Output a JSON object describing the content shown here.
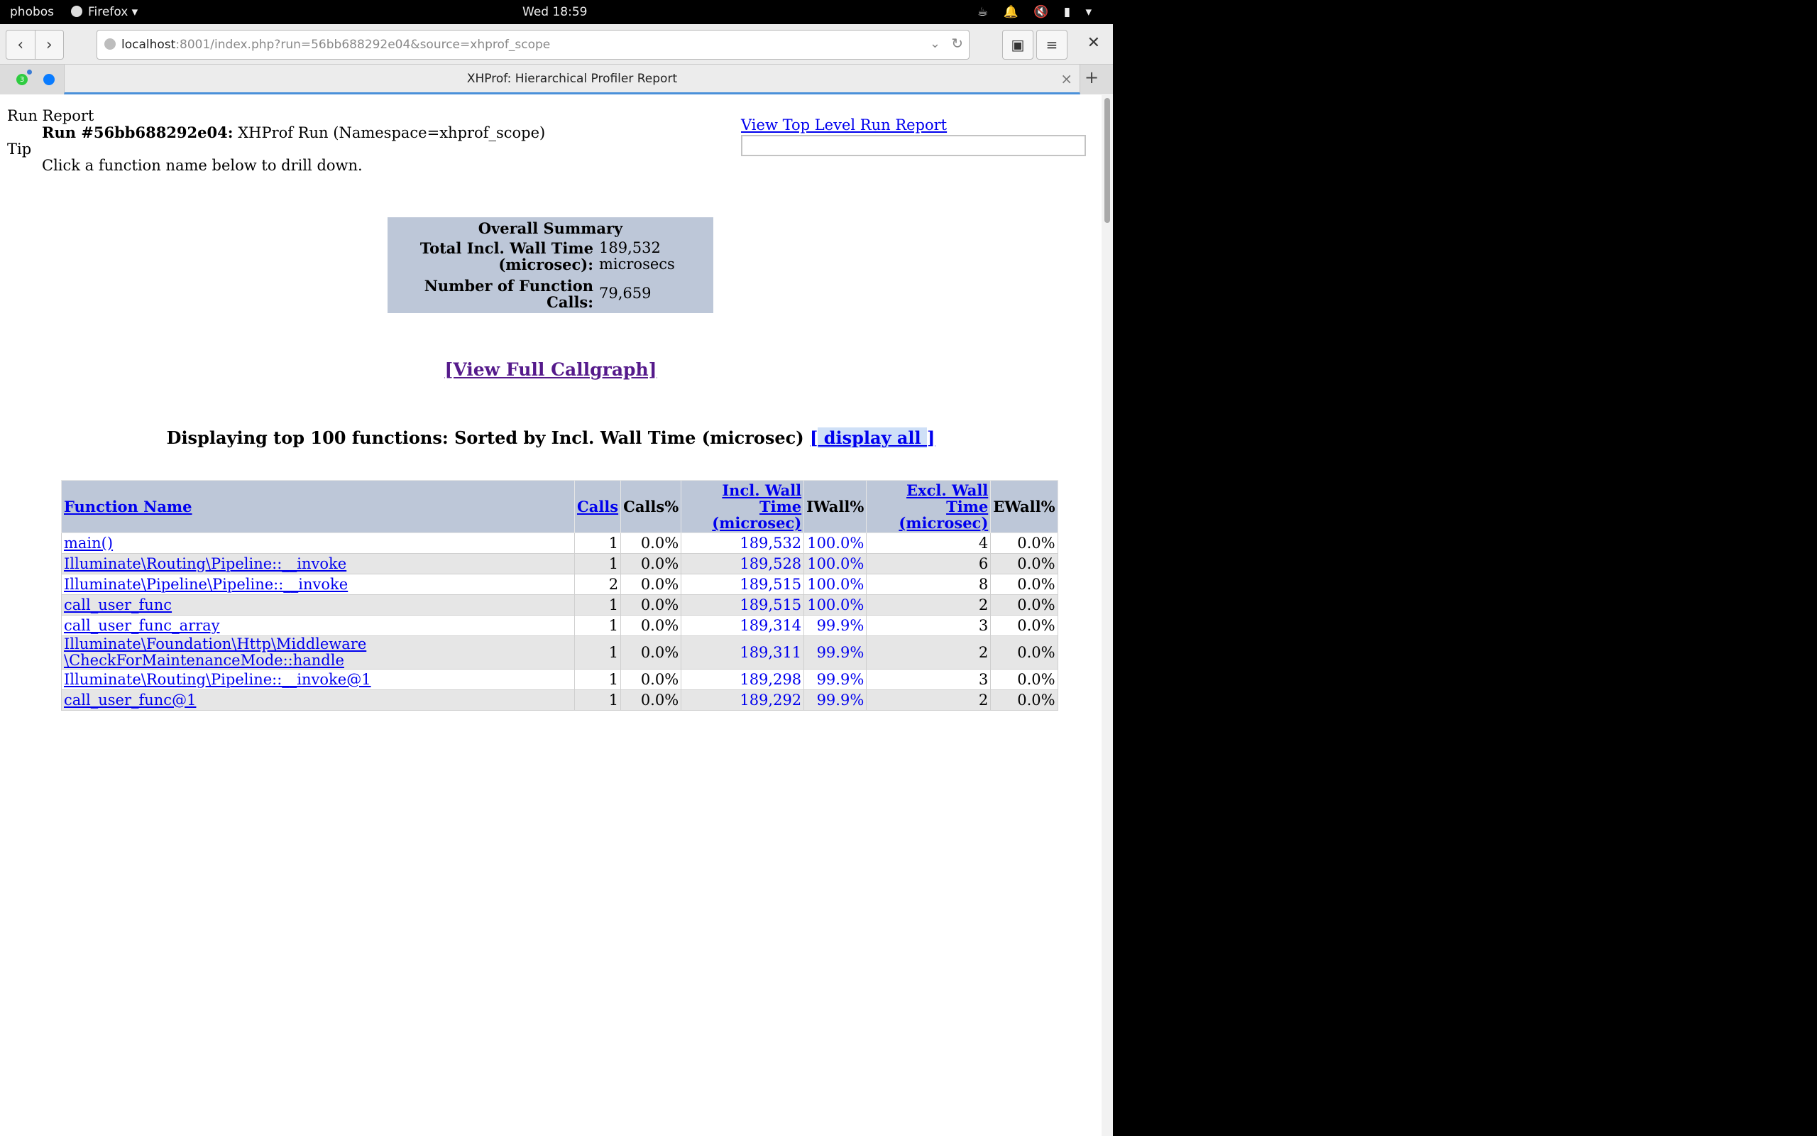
{
  "system_bar": {
    "activities": "phobos",
    "app_name": "Firefox",
    "app_dropdown": "▾",
    "clock": "Wed 18:59"
  },
  "browser": {
    "url_host": "localhost",
    "url_rest": ":8001/index.php?run=56bb688292e04&source=xhprof_scope",
    "tab_title": "XHProf: Hierarchical Profiler Report",
    "whatsapp_badge": "3"
  },
  "report": {
    "run_report_label": "Run Report",
    "run_id_label": "Run #56bb688292e04:",
    "run_desc": "XHProf Run (Namespace=xhprof_scope)",
    "tip_label": "Tip",
    "tip_text": "Click a function name below to drill down.",
    "top_level_link": "View Top Level Run Report"
  },
  "summary": {
    "title": "Overall Summary",
    "wall_label_1": "Total Incl. Wall Time",
    "wall_label_2": "(microsec):",
    "wall_value_1": "189,532",
    "wall_value_2": "microsecs",
    "calls_label_1": "Number of Function",
    "calls_label_2": "Calls:",
    "calls_value": "79,659"
  },
  "callgraph_link": "[View Full Callgraph]",
  "display": {
    "heading": "Displaying top 100 functions: Sorted by Incl. Wall Time (microsec)",
    "link_open": "[",
    "link_text": " display all ",
    "link_close": "]"
  },
  "table": {
    "headers": {
      "function": "Function Name",
      "calls": "Calls",
      "calls_pct": "Calls%",
      "incl_1": "Incl. Wall Time",
      "incl_2": "(microsec)",
      "iwall": "IWall%",
      "excl_1": "Excl. Wall Time",
      "excl_2": "(microsec)",
      "ewall": "EWall%"
    },
    "rows": [
      {
        "name": "main()",
        "calls": "1",
        "calls_pct": "0.0%",
        "incl": "189,532",
        "iwall": "100.0%",
        "excl": "4",
        "ewall": "0.0%"
      },
      {
        "name": "Illuminate\\Routing\\Pipeline::__invoke",
        "calls": "1",
        "calls_pct": "0.0%",
        "incl": "189,528",
        "iwall": "100.0%",
        "excl": "6",
        "ewall": "0.0%"
      },
      {
        "name": "Illuminate\\Pipeline\\Pipeline::__invoke",
        "calls": "2",
        "calls_pct": "0.0%",
        "incl": "189,515",
        "iwall": "100.0%",
        "excl": "8",
        "ewall": "0.0%"
      },
      {
        "name": "call_user_func",
        "calls": "1",
        "calls_pct": "0.0%",
        "incl": "189,515",
        "iwall": "100.0%",
        "excl": "2",
        "ewall": "0.0%"
      },
      {
        "name": "call_user_func_array",
        "calls": "1",
        "calls_pct": "0.0%",
        "incl": "189,314",
        "iwall": "99.9%",
        "excl": "3",
        "ewall": "0.0%"
      },
      {
        "name_1": "Illuminate\\Foundation\\Http\\Middleware",
        "name_2": "\\CheckForMaintenanceMode::handle",
        "calls": "1",
        "calls_pct": "0.0%",
        "incl": "189,311",
        "iwall": "99.9%",
        "excl": "2",
        "ewall": "0.0%"
      },
      {
        "name": "Illuminate\\Routing\\Pipeline::__invoke@1",
        "calls": "1",
        "calls_pct": "0.0%",
        "incl": "189,298",
        "iwall": "99.9%",
        "excl": "3",
        "ewall": "0.0%"
      },
      {
        "name": "call_user_func@1",
        "calls": "1",
        "calls_pct": "0.0%",
        "incl": "189,292",
        "iwall": "99.9%",
        "excl": "2",
        "ewall": "0.0%"
      }
    ]
  }
}
